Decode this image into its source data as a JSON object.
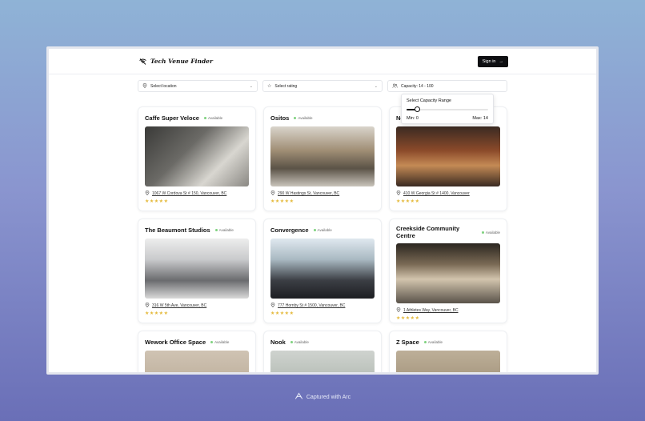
{
  "header": {
    "app_title": "Tech Venue Finder",
    "signin_label": "Sign in"
  },
  "filters": {
    "location_placeholder": "Select location",
    "rating_placeholder": "Select rating",
    "capacity_label": "Capacity: 14 - 100"
  },
  "capacity_popup": {
    "title": "Select Capacity Range",
    "min_label": "Min: 0",
    "max_label": "Max: 14",
    "slider_value": 0.13
  },
  "venues": [
    {
      "name": "Caffe Super Veloce",
      "status": "Available",
      "address": "1067 W Cordova St # 150, Vancouver, BC",
      "rating": 5
    },
    {
      "name": "Ositos",
      "status": "Available",
      "address": "290 W Hastings St, Vancouver, BC",
      "rating": 5
    },
    {
      "name": "Ne",
      "status": "",
      "address": "410 W Georgia St # 1400, Vancouver",
      "rating": 5
    },
    {
      "name": "The Beaumont Studios",
      "status": "Available",
      "address": "316 W 5th Ave, Vancouver, BC",
      "rating": 5
    },
    {
      "name": "Convergence",
      "status": "Available",
      "address": "777 Hornby St # 1500, Vancouver, BC",
      "rating": 5
    },
    {
      "name": "Creekside Community Centre",
      "status": "Available",
      "address": "1 Athletes Way, Vancouver, BC",
      "rating": 5
    },
    {
      "name": "Wework Office Space",
      "status": "Available",
      "address": "",
      "rating": 0
    },
    {
      "name": "Nook",
      "status": "Available",
      "address": "",
      "rating": 0
    },
    {
      "name": "Z Space",
      "status": "Available",
      "address": "",
      "rating": 0
    }
  ],
  "footer": {
    "captured_label": "Captured with Arc"
  },
  "colors": {
    "accent": "#0e0f12",
    "star": "#e4b93a",
    "available_dot": "#7ed27e"
  }
}
